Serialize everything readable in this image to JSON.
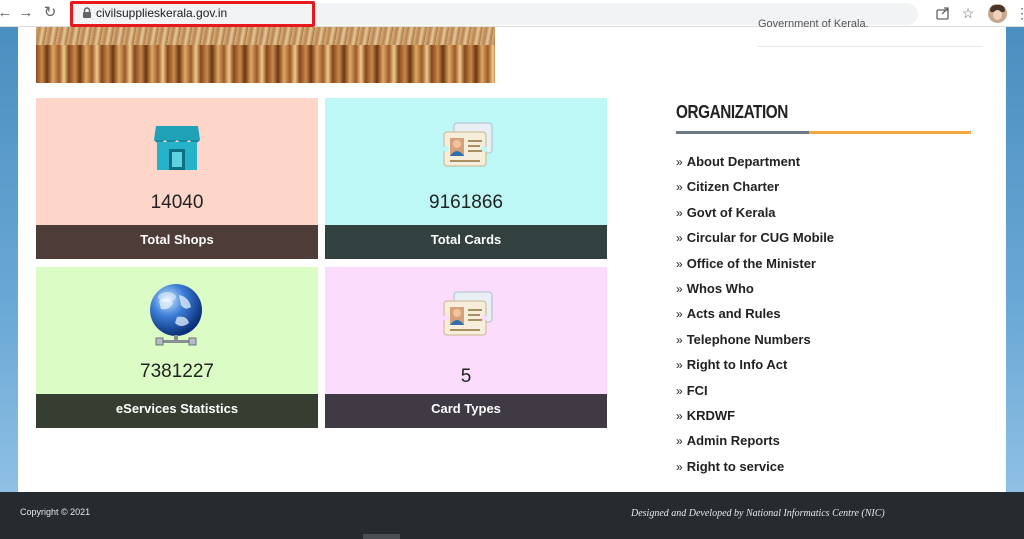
{
  "browser": {
    "url": "civilsupplieskerala.gov.in",
    "icons": [
      "back-icon",
      "forward-icon",
      "reload-icon",
      "lock-icon",
      "share-icon",
      "star-icon",
      "profile-avatar",
      "menu-icon"
    ]
  },
  "header": {
    "government_text": "Government of Kerala."
  },
  "stats": [
    {
      "value": "14040",
      "label": "Total Shops",
      "icon": "shop-icon"
    },
    {
      "value": "9161866",
      "label": "Total Cards",
      "icon": "id-card-icon"
    },
    {
      "value": "7381227",
      "label": "eServices Statistics",
      "icon": "globe-network-icon"
    },
    {
      "value": "5",
      "label": "Card Types",
      "icon": "id-card-icon"
    }
  ],
  "colors": {
    "tile_shops": "#fdd6c9",
    "tile_cards": "#bdf8f6",
    "tile_eservices": "#dcfcc6",
    "tile_cardtypes": "#fbdcfc",
    "bar_shops": "#4d3c37",
    "bar_cards": "#32403f",
    "bar_eservices": "#353e30",
    "bar_cardtypes": "#3f3a44",
    "accent": "#f2a93b"
  },
  "sidebar": {
    "title": "ORGANIZATION",
    "chevron": "»",
    "items": [
      "About Department",
      "Citizen Charter",
      "Govt of Kerala",
      "Circular for CUG Mobile",
      "Office of the Minister",
      "Whos Who",
      "Acts and Rules",
      "Telephone Numbers",
      "Right to Info Act",
      "FCI",
      "KRDWF",
      "Admin Reports",
      "Right to service"
    ]
  },
  "footer": {
    "copyright": "Copyright © 2021",
    "designed_by": "Designed and Developed by National Informatics Centre (NIC)"
  }
}
